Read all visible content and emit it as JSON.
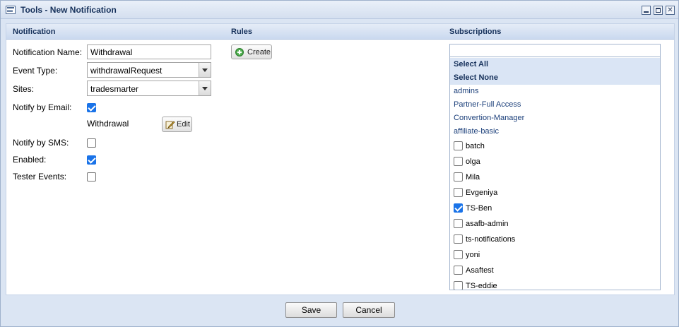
{
  "window": {
    "title": "Tools - New Notification",
    "controls": {
      "minimize": "",
      "maximize": "",
      "close": "✕"
    }
  },
  "sections": {
    "notification": "Notification",
    "rules": "Rules",
    "subscriptions": "Subscriptions"
  },
  "form": {
    "name_label": "Notification Name:",
    "name_value": "Withdrawal",
    "event_type_label": "Event Type:",
    "event_type_value": "withdrawalRequest",
    "sites_label": "Sites:",
    "sites_value": "tradesmarter",
    "notify_email_label": "Notify by Email:",
    "notify_email_checked": true,
    "email_template_name": "Withdrawal",
    "edit_button": "Edit",
    "notify_sms_label": "Notify by SMS:",
    "notify_sms_checked": false,
    "enabled_label": "Enabled:",
    "enabled_checked": true,
    "tester_events_label": "Tester Events:",
    "tester_events_checked": false
  },
  "rules": {
    "create_button": "Create"
  },
  "subscriptions": {
    "search_value": "",
    "select_all": "Select All",
    "select_none": "Select None",
    "groups": [
      "admins",
      "Partner-Full Access",
      "Convertion-Manager",
      "affiliate-basic"
    ],
    "users": [
      {
        "name": "batch",
        "checked": false
      },
      {
        "name": "olga",
        "checked": false
      },
      {
        "name": "Mila",
        "checked": false
      },
      {
        "name": "Evgeniya",
        "checked": false
      },
      {
        "name": "TS-Ben",
        "checked": true
      },
      {
        "name": "asafb-admin",
        "checked": false
      },
      {
        "name": "ts-notifications",
        "checked": false
      },
      {
        "name": "yoni",
        "checked": false
      },
      {
        "name": "Asaftest",
        "checked": false
      },
      {
        "name": "TS-eddie",
        "checked": false
      }
    ]
  },
  "footer": {
    "save": "Save",
    "cancel": "Cancel"
  }
}
